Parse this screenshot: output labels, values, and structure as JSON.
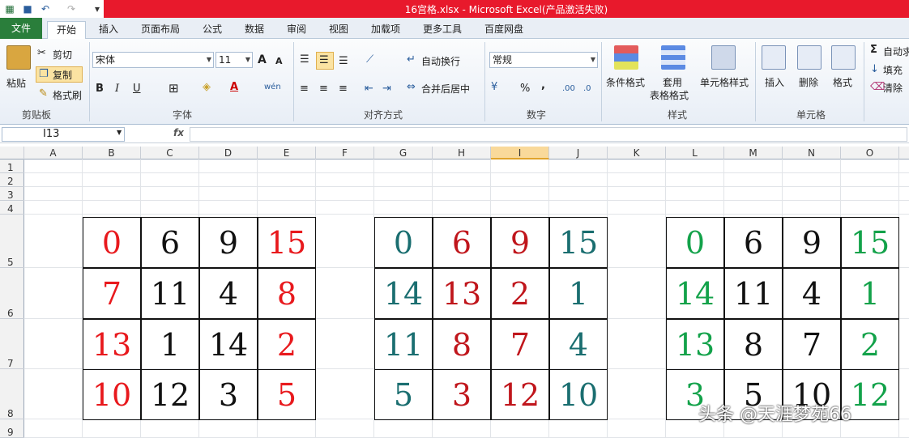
{
  "window": {
    "title": "16宫格.xlsx  -  Microsoft Excel(产品激活失败)"
  },
  "tabs": [
    "文件",
    "开始",
    "插入",
    "页面布局",
    "公式",
    "数据",
    "审阅",
    "视图",
    "加载项",
    "更多工具",
    "百度网盘"
  ],
  "active_tab": "开始",
  "ribbon": {
    "clipboard": {
      "paste": "粘贴",
      "cut": "剪切",
      "copy": "复制",
      "format_painter": "格式刷",
      "label": "剪贴板"
    },
    "font": {
      "name": "宋体",
      "size": "11",
      "label": "字体",
      "bold": "B",
      "italic": "I",
      "underline": "U",
      "grow": "A",
      "shrink": "A",
      "font_color_glyph": "A",
      "wen": "wén"
    },
    "alignment": {
      "wrap": "自动换行",
      "merge": "合并后居中",
      "label": "对齐方式"
    },
    "number": {
      "format": "常规",
      "percent": "%",
      "comma": ",",
      "label": "数字"
    },
    "styles": {
      "conditional": "条件格式",
      "table_a": "套用",
      "table_b": "表格格式",
      "cell_styles": "单元格样式",
      "label": "样式"
    },
    "cells": {
      "insert": "插入",
      "delete": "删除",
      "format": "格式",
      "label": "单元格"
    },
    "editing": {
      "autosum": "自动求",
      "fill": "填充",
      "clear": "清除"
    }
  },
  "formula_bar": {
    "name_box": "I13",
    "fx": "fx",
    "content": ""
  },
  "columns": [
    "A",
    "B",
    "C",
    "D",
    "E",
    "F",
    "G",
    "H",
    "I",
    "J",
    "K",
    "L",
    "M",
    "N",
    "O"
  ],
  "selected_column": "I",
  "rows": [
    "1",
    "2",
    "3",
    "4",
    "5",
    "6",
    "7",
    "8",
    "9"
  ],
  "colors": {
    "red": "#e8191d",
    "teal": "#1a6e70",
    "darkred": "#c0161c",
    "green": "#13a24a",
    "black": "#111111"
  },
  "grids": [
    {
      "name": "grid-1",
      "cells": [
        [
          {
            "v": "0",
            "c": "red"
          },
          {
            "v": "6",
            "c": "black"
          },
          {
            "v": "9",
            "c": "black"
          },
          {
            "v": "15",
            "c": "red"
          }
        ],
        [
          {
            "v": "7",
            "c": "red"
          },
          {
            "v": "11",
            "c": "black"
          },
          {
            "v": "4",
            "c": "black"
          },
          {
            "v": "8",
            "c": "red"
          }
        ],
        [
          {
            "v": "13",
            "c": "red"
          },
          {
            "v": "1",
            "c": "black"
          },
          {
            "v": "14",
            "c": "black"
          },
          {
            "v": "2",
            "c": "red"
          }
        ],
        [
          {
            "v": "10",
            "c": "red"
          },
          {
            "v": "12",
            "c": "black"
          },
          {
            "v": "3",
            "c": "black"
          },
          {
            "v": "5",
            "c": "red"
          }
        ]
      ]
    },
    {
      "name": "grid-2",
      "cells": [
        [
          {
            "v": "0",
            "c": "teal"
          },
          {
            "v": "6",
            "c": "darkred"
          },
          {
            "v": "9",
            "c": "darkred"
          },
          {
            "v": "15",
            "c": "teal"
          }
        ],
        [
          {
            "v": "14",
            "c": "teal"
          },
          {
            "v": "13",
            "c": "darkred"
          },
          {
            "v": "2",
            "c": "darkred"
          },
          {
            "v": "1",
            "c": "teal"
          }
        ],
        [
          {
            "v": "11",
            "c": "teal"
          },
          {
            "v": "8",
            "c": "darkred"
          },
          {
            "v": "7",
            "c": "darkred"
          },
          {
            "v": "4",
            "c": "teal"
          }
        ],
        [
          {
            "v": "5",
            "c": "teal"
          },
          {
            "v": "3",
            "c": "darkred"
          },
          {
            "v": "12",
            "c": "darkred"
          },
          {
            "v": "10",
            "c": "teal"
          }
        ]
      ]
    },
    {
      "name": "grid-3",
      "cells": [
        [
          {
            "v": "0",
            "c": "green"
          },
          {
            "v": "6",
            "c": "black"
          },
          {
            "v": "9",
            "c": "black"
          },
          {
            "v": "15",
            "c": "green"
          }
        ],
        [
          {
            "v": "14",
            "c": "green"
          },
          {
            "v": "11",
            "c": "black"
          },
          {
            "v": "4",
            "c": "black"
          },
          {
            "v": "1",
            "c": "green"
          }
        ],
        [
          {
            "v": "13",
            "c": "green"
          },
          {
            "v": "8",
            "c": "black"
          },
          {
            "v": "7",
            "c": "black"
          },
          {
            "v": "2",
            "c": "green"
          }
        ],
        [
          {
            "v": "3",
            "c": "green"
          },
          {
            "v": "5",
            "c": "black"
          },
          {
            "v": "10",
            "c": "black"
          },
          {
            "v": "12",
            "c": "green"
          }
        ]
      ]
    }
  ],
  "watermark": "头条 @天涯梦苑66"
}
